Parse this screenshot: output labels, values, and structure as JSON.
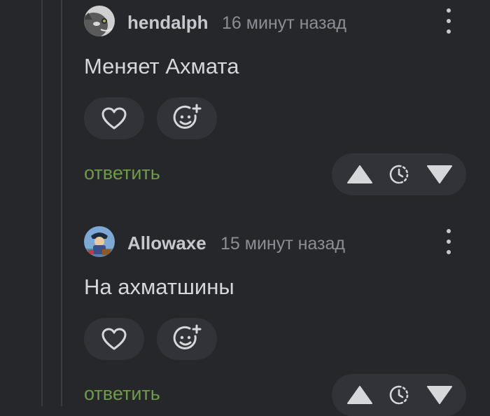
{
  "comments": [
    {
      "author": "hendalph",
      "time": "16 минут назад",
      "text": "Меняет Ахмата",
      "reply_label": "ответить",
      "avatar_icon": "cat-avatar"
    },
    {
      "author": "Allowaxe",
      "time": "15 минут назад",
      "text": "На ахматшины",
      "reply_label": "ответить",
      "avatar_icon": "pirate-avatar"
    }
  ],
  "icons": {
    "like": "heart-icon",
    "react": "emoji-add-icon",
    "upvote": "arrow-up-icon",
    "rating": "clock-icon",
    "downvote": "arrow-down-icon",
    "menu": "kebab-menu-icon"
  },
  "colors": {
    "background": "#26272b",
    "pill": "#323338",
    "author": "#c7c8cd",
    "meta": "#8d8e94",
    "text": "#d6d7db",
    "reply": "#6e9b47",
    "thread_line": "#3b3c41"
  }
}
